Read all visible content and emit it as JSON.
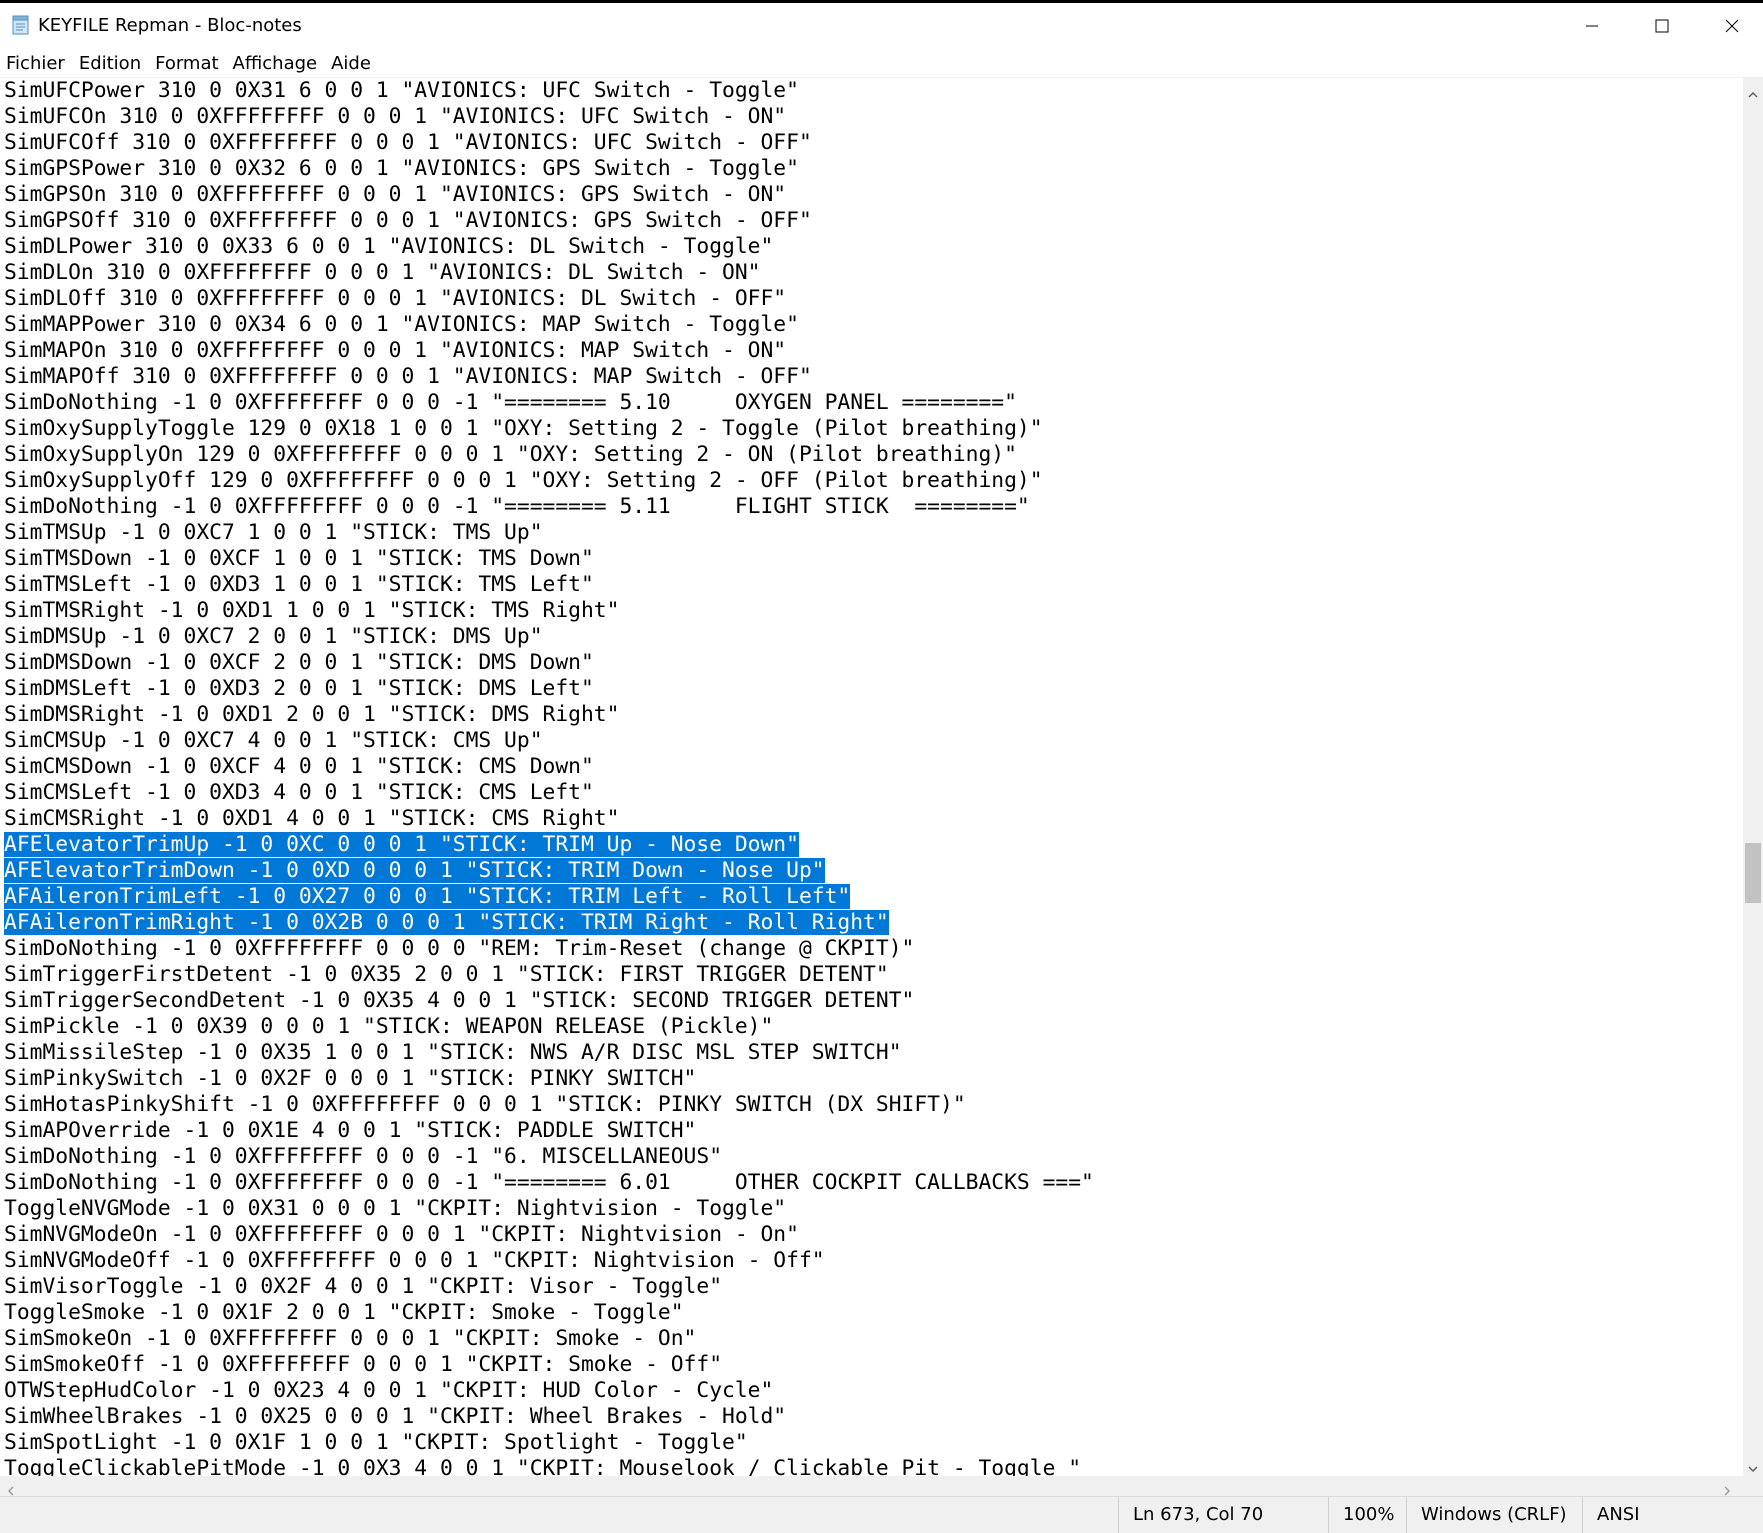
{
  "window": {
    "title": "KEYFILE Repman - Bloc-notes",
    "icon": "notepad-icon",
    "controls": [
      "minimize-icon",
      "maximize-icon",
      "close-icon"
    ]
  },
  "menu": [
    {
      "label": "Fichier"
    },
    {
      "label": "Edition"
    },
    {
      "label": "Format"
    },
    {
      "label": "Affichage"
    },
    {
      "label": "Aide"
    }
  ],
  "editor": {
    "lines": [
      "SimUFCPower 310 0 0X31 6 0 0 1 \"AVIONICS: UFC Switch - Toggle\"",
      "SimUFCOn 310 0 0XFFFFFFFF 0 0 0 1 \"AVIONICS: UFC Switch - ON\"",
      "SimUFCOff 310 0 0XFFFFFFFF 0 0 0 1 \"AVIONICS: UFC Switch - OFF\"",
      "SimGPSPower 310 0 0X32 6 0 0 1 \"AVIONICS: GPS Switch - Toggle\"",
      "SimGPSOn 310 0 0XFFFFFFFF 0 0 0 1 \"AVIONICS: GPS Switch - ON\"",
      "SimGPSOff 310 0 0XFFFFFFFF 0 0 0 1 \"AVIONICS: GPS Switch - OFF\"",
      "SimDLPower 310 0 0X33 6 0 0 1 \"AVIONICS: DL Switch - Toggle\"",
      "SimDLOn 310 0 0XFFFFFFFF 0 0 0 1 \"AVIONICS: DL Switch - ON\"",
      "SimDLOff 310 0 0XFFFFFFFF 0 0 0 1 \"AVIONICS: DL Switch - OFF\"",
      "SimMAPPower 310 0 0X34 6 0 0 1 \"AVIONICS: MAP Switch - Toggle\"",
      "SimMAPOn 310 0 0XFFFFFFFF 0 0 0 1 \"AVIONICS: MAP Switch - ON\"",
      "SimMAPOff 310 0 0XFFFFFFFF 0 0 0 1 \"AVIONICS: MAP Switch - OFF\"",
      "SimDoNothing -1 0 0XFFFFFFFF 0 0 0 -1 \"======== 5.10     OXYGEN PANEL ========\"",
      "SimOxySupplyToggle 129 0 0X18 1 0 0 1 \"OXY: Setting 2 - Toggle (Pilot breathing)\"",
      "SimOxySupplyOn 129 0 0XFFFFFFFF 0 0 0 1 \"OXY: Setting 2 - ON (Pilot breathing)\"",
      "SimOxySupplyOff 129 0 0XFFFFFFFF 0 0 0 1 \"OXY: Setting 2 - OFF (Pilot breathing)\"",
      "SimDoNothing -1 0 0XFFFFFFFF 0 0 0 -1 \"======== 5.11     FLIGHT STICK  ========\"",
      "SimTMSUp -1 0 0XC7 1 0 0 1 \"STICK: TMS Up\"",
      "SimTMSDown -1 0 0XCF 1 0 0 1 \"STICK: TMS Down\"",
      "SimTMSLeft -1 0 0XD3 1 0 0 1 \"STICK: TMS Left\"",
      "SimTMSRight -1 0 0XD1 1 0 0 1 \"STICK: TMS Right\"",
      "SimDMSUp -1 0 0XC7 2 0 0 1 \"STICK: DMS Up\"",
      "SimDMSDown -1 0 0XCF 2 0 0 1 \"STICK: DMS Down\"",
      "SimDMSLeft -1 0 0XD3 2 0 0 1 \"STICK: DMS Left\"",
      "SimDMSRight -1 0 0XD1 2 0 0 1 \"STICK: DMS Right\"",
      "SimCMSUp -1 0 0XC7 4 0 0 1 \"STICK: CMS Up\"",
      "SimCMSDown -1 0 0XCF 4 0 0 1 \"STICK: CMS Down\"",
      "SimCMSLeft -1 0 0XD3 4 0 0 1 \"STICK: CMS Left\"",
      "SimCMSRight -1 0 0XD1 4 0 0 1 \"STICK: CMS Right\"",
      "AFElevatorTrimUp -1 0 0XC 0 0 0 1 \"STICK: TRIM Up - Nose Down\"",
      "AFElevatorTrimDown -1 0 0XD 0 0 0 1 \"STICK: TRIM Down - Nose Up\"",
      "AFAileronTrimLeft -1 0 0X27 0 0 0 1 \"STICK: TRIM Left - Roll Left\"",
      "AFAileronTrimRight -1 0 0X2B 0 0 0 1 \"STICK: TRIM Right - Roll Right\"",
      "SimDoNothing -1 0 0XFFFFFFFF 0 0 0 0 \"REM: Trim-Reset (change @ CKPIT)\"",
      "SimTriggerFirstDetent -1 0 0X35 2 0 0 1 \"STICK: FIRST TRIGGER DETENT\"",
      "SimTriggerSecondDetent -1 0 0X35 4 0 0 1 \"STICK: SECOND TRIGGER DETENT\"",
      "SimPickle -1 0 0X39 0 0 0 1 \"STICK: WEAPON RELEASE (Pickle)\"",
      "SimMissileStep -1 0 0X35 1 0 0 1 \"STICK: NWS A/R DISC MSL STEP SWITCH\"",
      "SimPinkySwitch -1 0 0X2F 0 0 0 1 \"STICK: PINKY SWITCH\"",
      "SimHotasPinkyShift -1 0 0XFFFFFFFF 0 0 0 1 \"STICK: PINKY SWITCH (DX SHIFT)\"",
      "SimAPOverride -1 0 0X1E 4 0 0 1 \"STICK: PADDLE SWITCH\"",
      "SimDoNothing -1 0 0XFFFFFFFF 0 0 0 -1 \"6. MISCELLANEOUS\"",
      "SimDoNothing -1 0 0XFFFFFFFF 0 0 0 -1 \"======== 6.01     OTHER COCKPIT CALLBACKS ===\"",
      "ToggleNVGMode -1 0 0X31 0 0 0 1 \"CKPIT: Nightvision - Toggle\"",
      "SimNVGModeOn -1 0 0XFFFFFFFF 0 0 0 1 \"CKPIT: Nightvision - On\"",
      "SimNVGModeOff -1 0 0XFFFFFFFF 0 0 0 1 \"CKPIT: Nightvision - Off\"",
      "SimVisorToggle -1 0 0X2F 4 0 0 1 \"CKPIT: Visor - Toggle\"",
      "ToggleSmoke -1 0 0X1F 2 0 0 1 \"CKPIT: Smoke - Toggle\"",
      "SimSmokeOn -1 0 0XFFFFFFFF 0 0 0 1 \"CKPIT: Smoke - On\"",
      "SimSmokeOff -1 0 0XFFFFFFFF 0 0 0 1 \"CKPIT: Smoke - Off\"",
      "OTWStepHudColor -1 0 0X23 4 0 0 1 \"CKPIT: HUD Color - Cycle\"",
      "SimWheelBrakes -1 0 0X25 0 0 0 1 \"CKPIT: Wheel Brakes - Hold\"",
      "SimSpotLight -1 0 0X1F 1 0 0 1 \"CKPIT: Spotlight - Toggle\"",
      "ToggleClickablePitMode -1 0 0X3 4 0 0 1 \"CKPIT: Mouselook / Clickable Pit - Toggle \""
    ],
    "selected_line_indices": [
      29,
      30,
      31,
      32
    ],
    "selection_color": "#0078d7"
  },
  "statusbar": {
    "position": "Ln 673, Col 70",
    "zoom": "100%",
    "line_ending": "Windows (CRLF)",
    "encoding": "ANSI"
  }
}
